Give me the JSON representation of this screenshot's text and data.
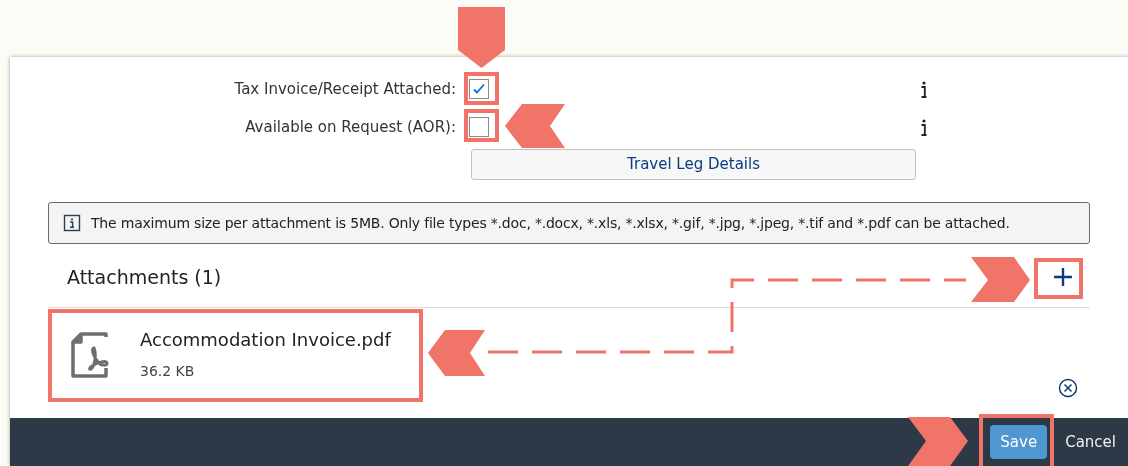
{
  "form_fields": [
    {
      "label": "Tax Invoice/Receipt Attached:",
      "checked": true
    },
    {
      "label": "Available on Request (AOR):",
      "checked": false
    }
  ],
  "travel_leg_button": "Travel Leg Details",
  "info_message": "The maximum size per attachment is 5MB. Only file types *.doc, *.docx, *.xls, *.xlsx, *.gif, *.jpg, *.jpeg, *.tif and *.pdf can be attached.",
  "attachments": {
    "title": "Attachments (1)",
    "items": [
      {
        "name": "Accommodation Invoice.pdf",
        "size": "36.2 KB"
      }
    ]
  },
  "footer": {
    "buttons": [
      {
        "label": "Save",
        "kind": "primary"
      },
      {
        "label": "Cancel",
        "kind": "plain"
      }
    ]
  }
}
